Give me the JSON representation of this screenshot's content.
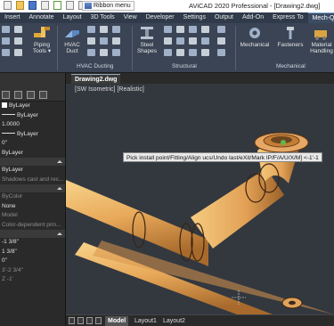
{
  "titlebar": {
    "ribbon_menu_label": "Ribbon menu",
    "app_title": "AViCAD 2020 Professional - [Drawing2.dwg]"
  },
  "tabs": [
    "Insert",
    "Annotate",
    "Layout",
    "3D Tools",
    "View",
    "Developer",
    "Settings",
    "Output",
    "Add-On",
    "Express To",
    "Mech-Q"
  ],
  "active_tab": "Mech-Q",
  "ribbon": {
    "piping_tools": "Piping Tools ▾",
    "hvac_duct": "HVAC Duct",
    "hvac_ducting": "HVAC Ducting",
    "steel_shapes": "Steel Shapes",
    "structural": "Structural",
    "mechanical_btn": "Mechanical",
    "fasteners": "Fasteners",
    "material_handling": "Material Handling",
    "mechanical_group": "Mechanical"
  },
  "document": {
    "tab": "Drawing2.dwg",
    "view_label": "[SW Isometric] [Realistic]",
    "command_prompt": "Pick install point/Fitting/Align ucs/Undo last/eXit/Mark IP/F/A/U/X/M] <-1'-1"
  },
  "palette": {
    "rows": [
      {
        "text": "ByLayer",
        "style": "swatch"
      },
      {
        "text": "ByLayer",
        "style": "dash"
      },
      {
        "text": "1.0000",
        "style": "plain"
      },
      {
        "text": "ByLayer",
        "style": "dash"
      },
      {
        "text": "0\"",
        "style": "plain"
      },
      {
        "text": "ByLayer",
        "style": "plain"
      },
      {
        "text": "",
        "style": "head"
      },
      {
        "text": "ByLayer",
        "style": "plain"
      },
      {
        "text": "Shadows cast and rec...",
        "style": "dim"
      },
      {
        "text": "",
        "style": "head"
      },
      {
        "text": "ByColor",
        "style": "dim"
      },
      {
        "text": "None",
        "style": "plain"
      },
      {
        "text": "Model",
        "style": "dim"
      },
      {
        "text": "Color-dependent prin...",
        "style": "dim"
      },
      {
        "text": "",
        "style": "head"
      },
      {
        "text": "-1 3/8\"",
        "style": "plain"
      },
      {
        "text": "1 3/8\"",
        "style": "plain"
      },
      {
        "text": "0\"",
        "style": "plain"
      },
      {
        "text": "3'-2 3/4\"",
        "style": "dim"
      },
      {
        "text": "Z -1'",
        "style": "dim"
      }
    ]
  },
  "layout_tabs": [
    "Model",
    "Layout1",
    "Layout2"
  ],
  "active_layout": "Model"
}
